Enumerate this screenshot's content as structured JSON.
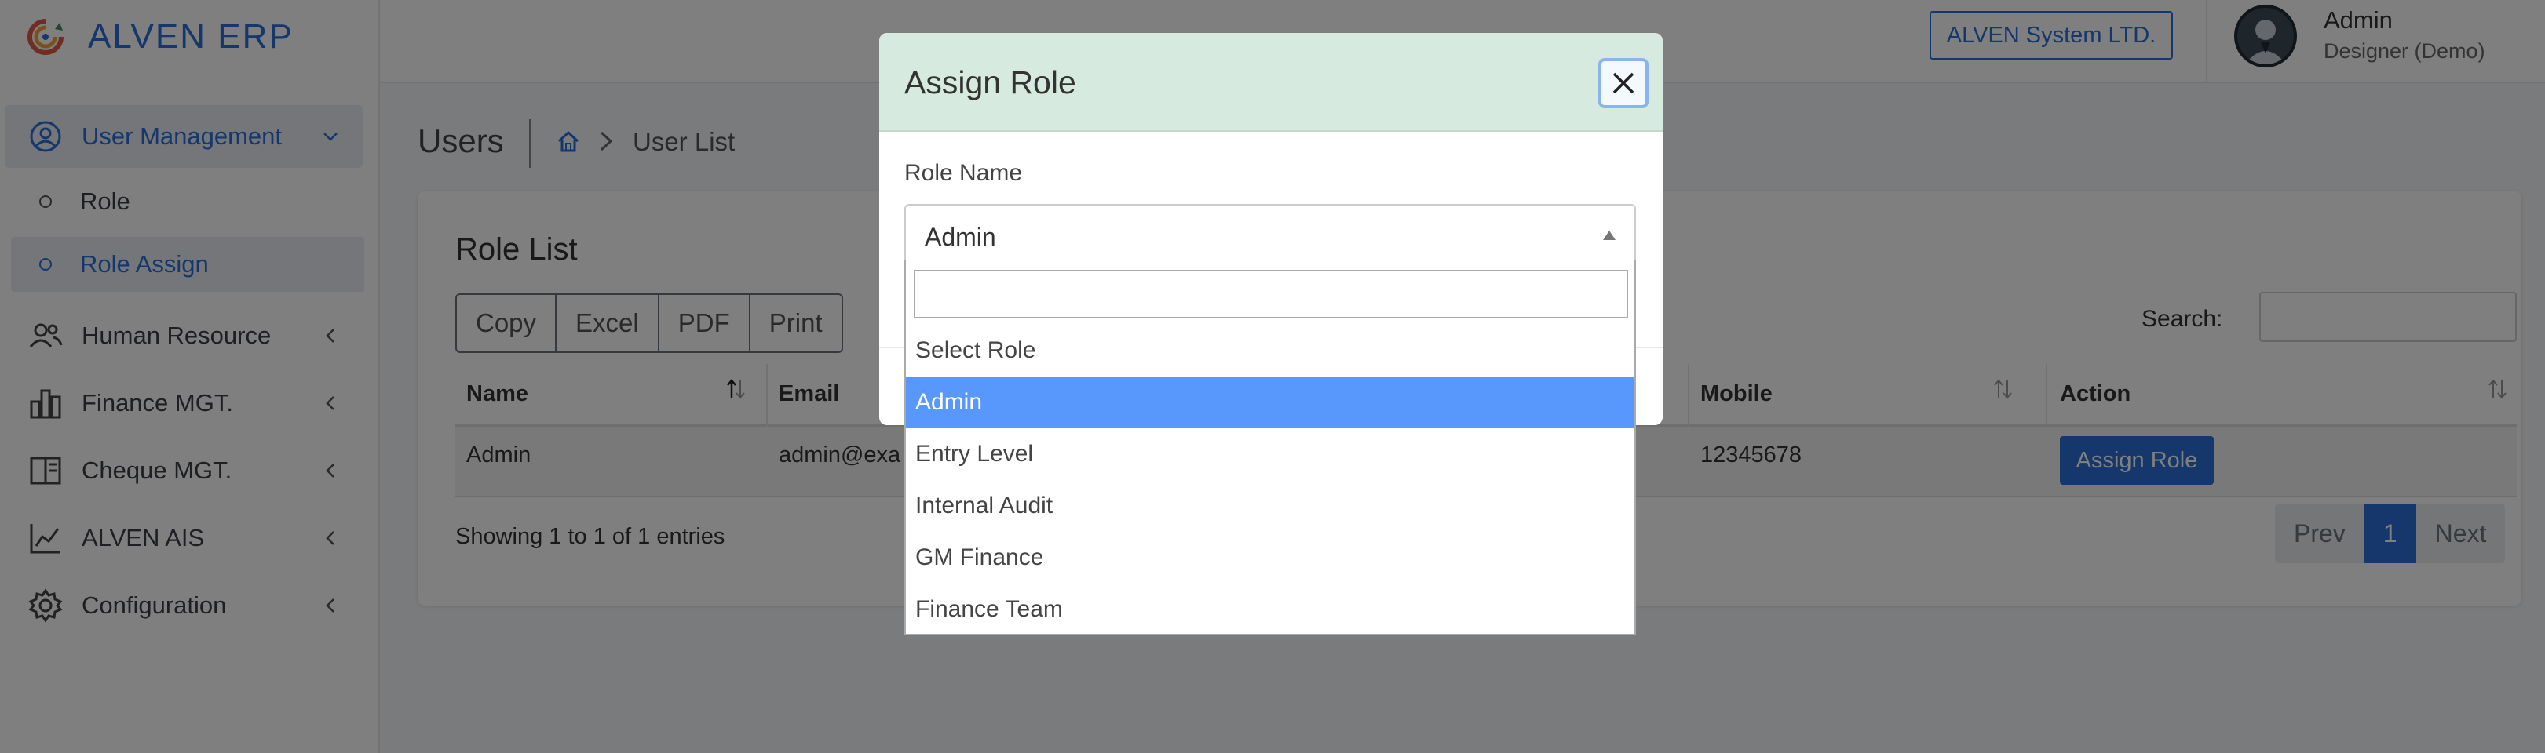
{
  "app": {
    "brand": "ALVEN ERP"
  },
  "header": {
    "company": "ALVEN System LTD.",
    "user_name": "Admin",
    "user_role": "Designer (Demo)"
  },
  "sidebar": {
    "items": [
      {
        "label": "User Management",
        "icon": "user-circle-icon",
        "state": "expanded"
      },
      {
        "label": "Human Resource",
        "icon": "users-icon"
      },
      {
        "label": "Finance MGT.",
        "icon": "bar-chart-icon"
      },
      {
        "label": "Cheque MGT.",
        "icon": "book-icon"
      },
      {
        "label": "ALVEN AIS",
        "icon": "line-chart-icon"
      },
      {
        "label": "Configuration",
        "icon": "gear-icon"
      }
    ],
    "subitems": [
      {
        "label": "Role"
      },
      {
        "label": "Role Assign",
        "active": true
      }
    ]
  },
  "page": {
    "title": "Users",
    "breadcrumb": "User List"
  },
  "card": {
    "title": "Role List",
    "buttons": [
      "Copy",
      "Excel",
      "PDF",
      "Print"
    ],
    "search_label": "Search:",
    "columns": [
      "Name",
      "Email",
      "Mobile",
      "Action"
    ],
    "rows": [
      {
        "name": "Admin",
        "email": "admin@exa",
        "mobile": "12345678",
        "action": "Assign Role"
      }
    ],
    "showing": "Showing 1 to 1 of 1 entries",
    "pagination": {
      "prev": "Prev",
      "current": "1",
      "next": "Next"
    }
  },
  "modal": {
    "title": "Assign Role",
    "field_label": "Role Name",
    "selected": "Admin",
    "options": [
      "Select Role",
      "Admin",
      "Entry Level",
      "Internal Audit",
      "GM Finance",
      "Finance Team"
    ]
  },
  "colors": {
    "accent": "#2a6fd6",
    "modal_header": "#d7eadf",
    "option_highlight": "#5897fb"
  }
}
